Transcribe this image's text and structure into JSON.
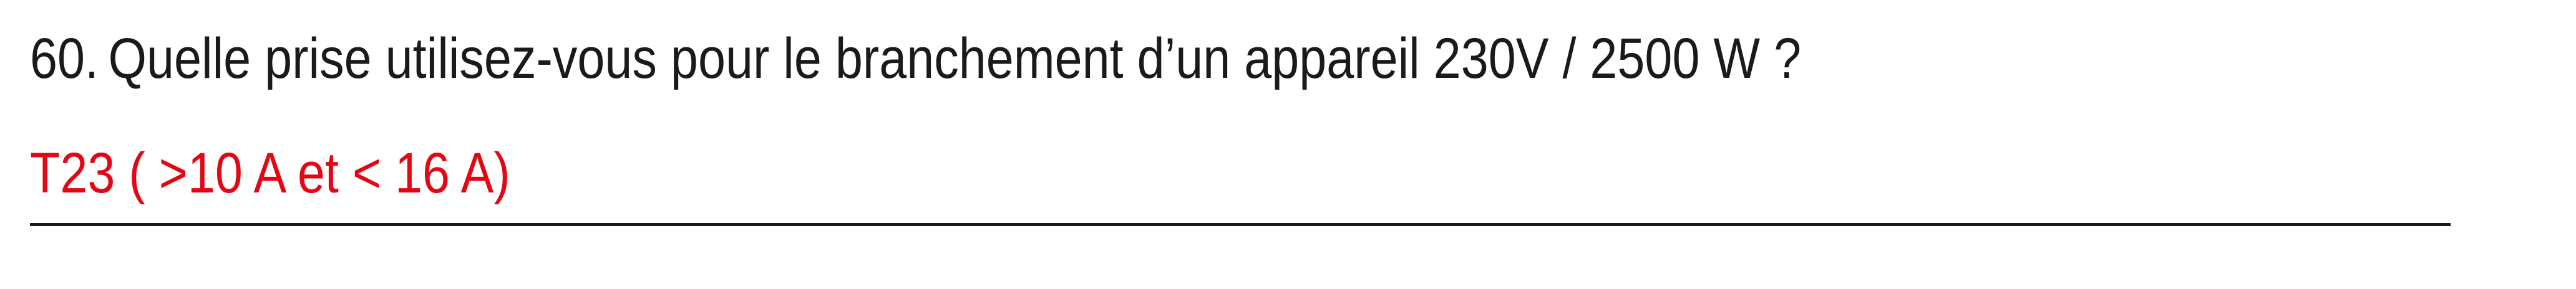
{
  "question": {
    "number": "60.",
    "text": "Quelle prise utilisez-vous pour le branchement d’un appareil 230V / 2500 W ?"
  },
  "answer": {
    "text": "T23 ( >10 A et < 16 A)",
    "color": "#e30613"
  }
}
